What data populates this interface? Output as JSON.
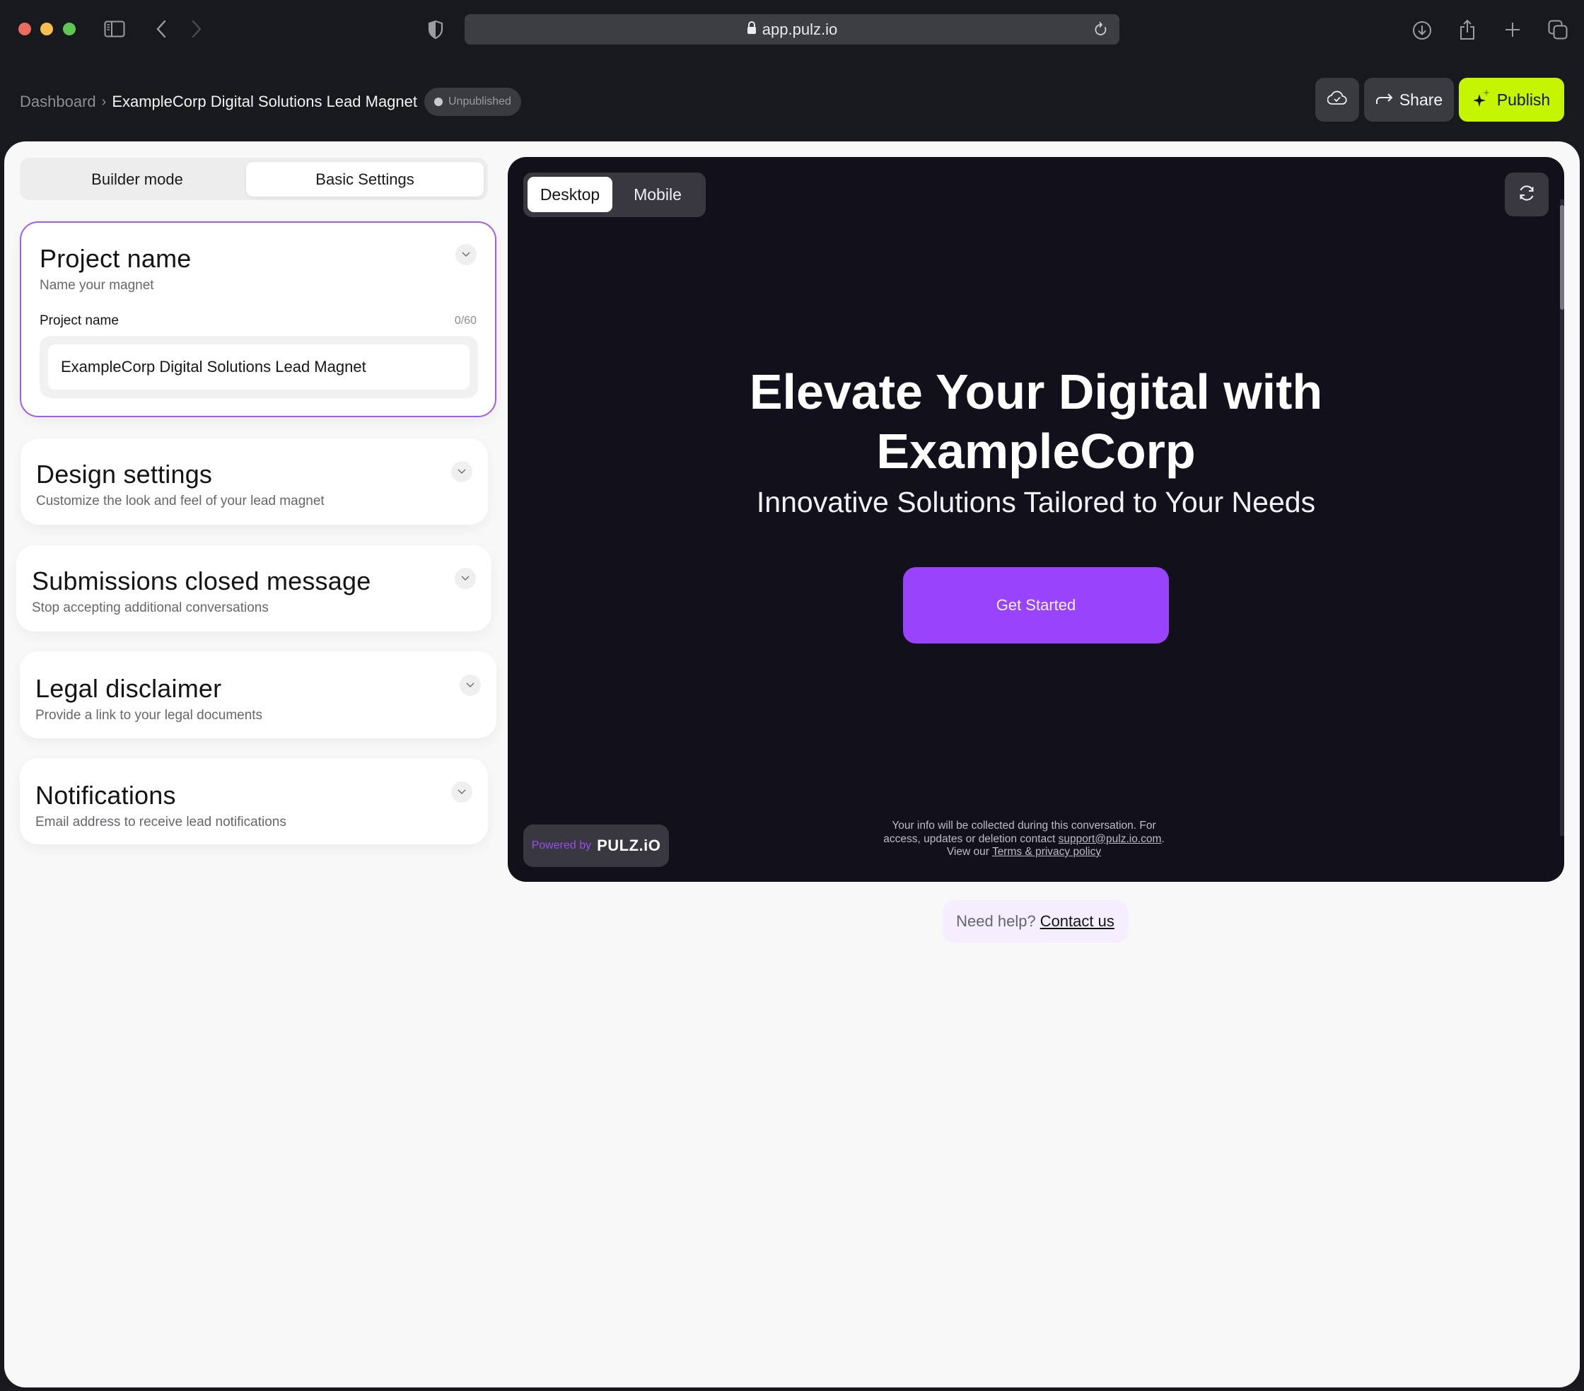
{
  "browser": {
    "url": "app.pulz.io",
    "icons": [
      "sidebar-icon",
      "back-icon",
      "forward-icon",
      "shield-icon",
      "lock-icon",
      "reload-icon",
      "download-icon",
      "share-icon",
      "new-tab-icon",
      "tabs-overview-icon"
    ]
  },
  "header": {
    "breadcrumb_root": "Dashboard",
    "breadcrumb_separator": "›",
    "breadcrumb_current": "ExampleCorp Digital Solutions Lead Magnet",
    "status_badge": "Unpublished",
    "share_label": "Share",
    "publish_label": "Publish",
    "publish_color": "#c6f500"
  },
  "mode_tabs": {
    "builder": "Builder mode",
    "basic": "Basic Settings",
    "active": "Basic Settings"
  },
  "settings": {
    "project": {
      "title": "Project name",
      "subtitle": "Name your magnet",
      "field_label": "Project name",
      "counter": "0/60",
      "value": "ExampleCorp Digital Solutions Lead Magnet"
    },
    "design": {
      "title": "Design settings",
      "subtitle": "Customize the look and feel of your lead magnet"
    },
    "submissions": {
      "title": "Submissions closed message",
      "subtitle": "Stop accepting additional conversations"
    },
    "legal": {
      "title": "Legal disclaimer",
      "subtitle": "Provide a link to your legal documents"
    },
    "notifications": {
      "title": "Notifications",
      "subtitle": "Email address to receive lead notifications"
    }
  },
  "preview": {
    "device_tabs": {
      "desktop": "Desktop",
      "mobile": "Mobile",
      "active": "Desktop"
    },
    "hero_title_line1": "Elevate Your Digital with",
    "hero_title_line2": "ExampleCorp",
    "hero_subtitle": "Innovative Solutions Tailored to Your Needs",
    "cta_label": "Get Started",
    "cta_color": "#9a43fd",
    "powered_by": "Powered by",
    "powered_logo": "PULZ.iO",
    "legal_line1": "Your info will be collected during this conversation. For",
    "legal_line2_prefix": "access, updates or deletion contact ",
    "legal_email": "support@pulz.io.com",
    "legal_line2_suffix": ".",
    "legal_line3_prefix": "View our ",
    "legal_terms": "Terms & privacy policy"
  },
  "help": {
    "question": "Need help?",
    "link": "Contact us"
  }
}
